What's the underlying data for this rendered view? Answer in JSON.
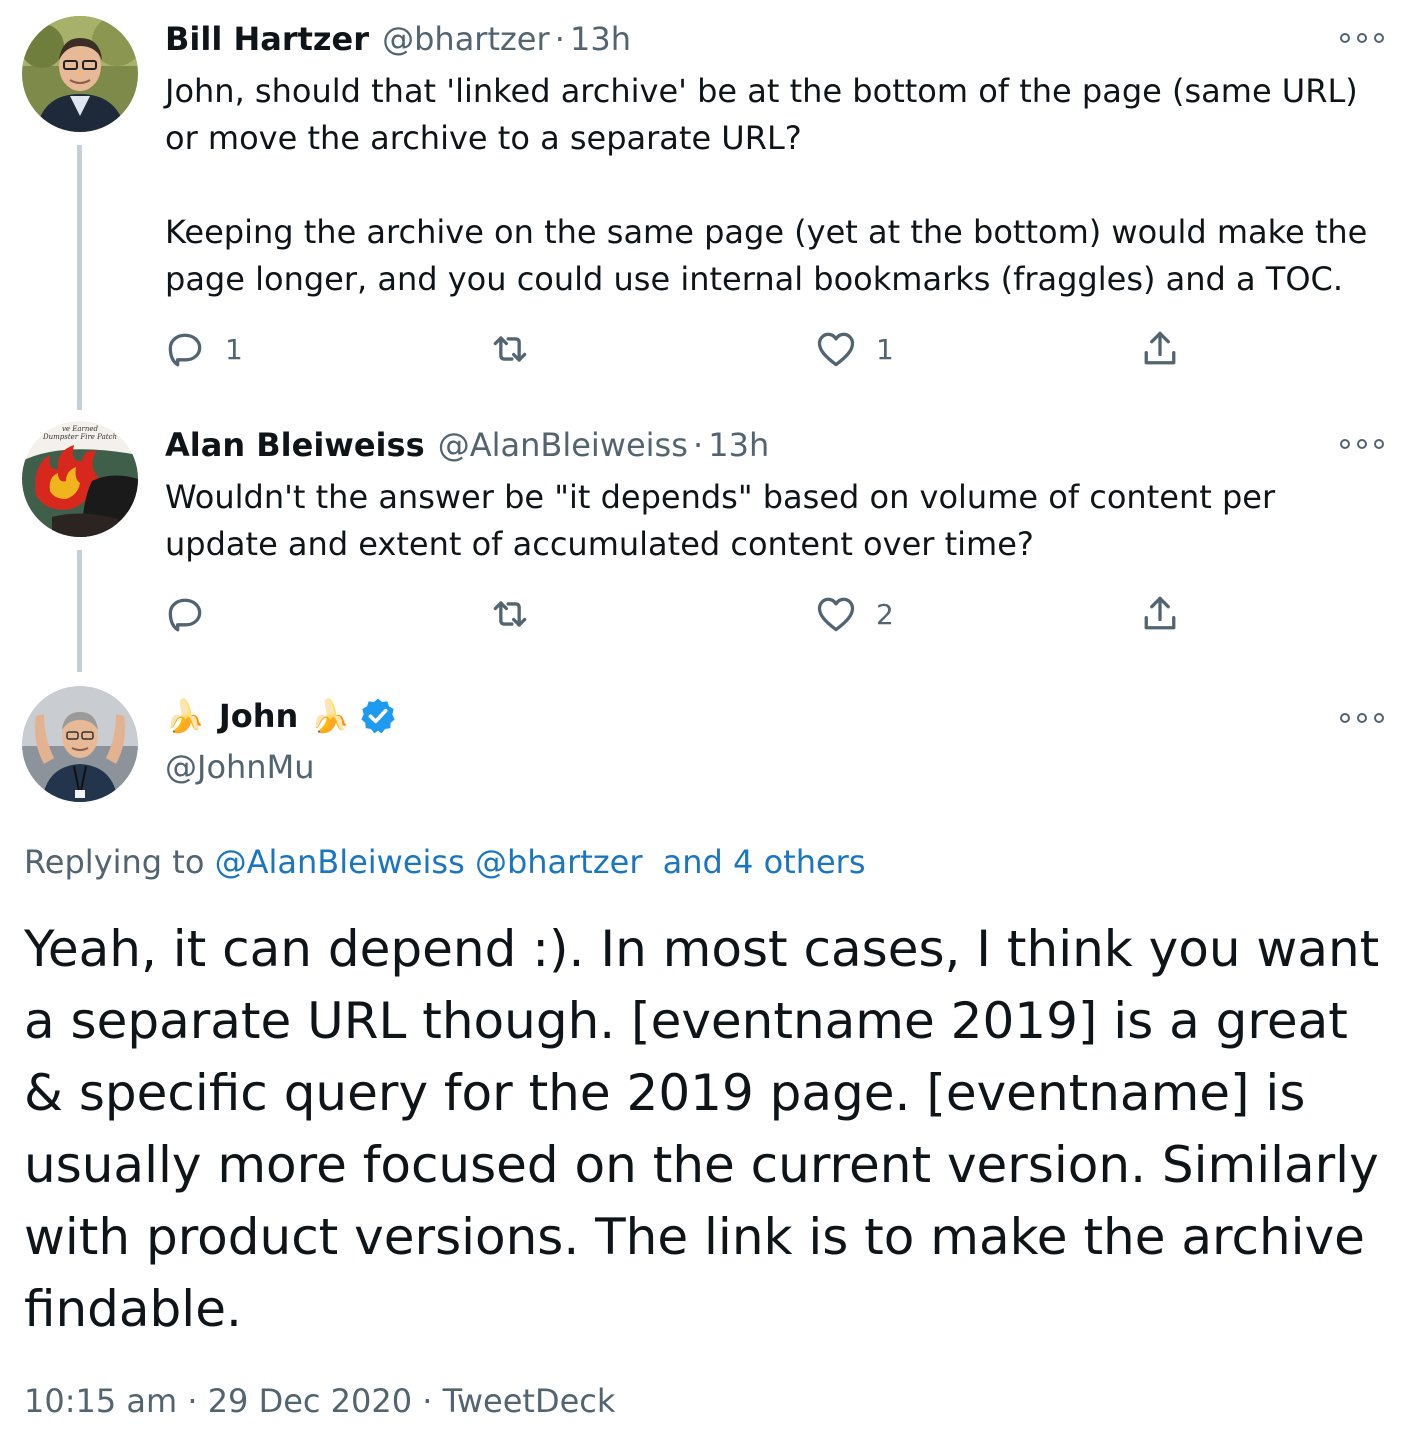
{
  "tweets": [
    {
      "name": "Bill Hartzer",
      "handle": "@bhartzer",
      "time": "13h",
      "text": "John, should that 'linked archive' be at the bottom of the page (same URL) or move the archive to a separate URL?\n\nKeeping the archive on the same page (yet at the bottom) would make the page longer, and you could use internal bookmarks (fraggles) and a TOC.",
      "reply_count": "1",
      "retweet_count": "",
      "like_count": "1"
    },
    {
      "name": "Alan Bleiweiss",
      "handle": "@AlanBleiweiss",
      "time": "13h",
      "avatar_caption_1": "ve Earned",
      "avatar_caption_2": "Dumpster Fire Patch",
      "text": "Wouldn't the answer be \"it depends\" based on volume of content per update and extent of accumulated content over time?",
      "reply_count": "",
      "retweet_count": "",
      "like_count": "2"
    }
  ],
  "main_tweet": {
    "name_emoji": "🍌",
    "name": "John",
    "handle": "@JohnMu",
    "replying_label": "Replying to",
    "replying_users": [
      "@AlanBleiweiss",
      "@bhartzer"
    ],
    "replying_others": "and 4 others",
    "text": "Yeah, it can depend :). In most cases, I think you want a separate URL though. [eventname 2019] is a great & specific query for the 2019 page. [eventname] is usually more focused on the current version. Similarly with product versions. The link is to make the archive findable.",
    "time": "10:15 am",
    "date": "29 Dec 2020",
    "source": "TweetDeck",
    "separator": "·"
  },
  "separator": "·",
  "colors": {
    "text": "#0f1419",
    "muted": "#536471",
    "link": "#1b76c1",
    "thread_line": "#c4cfd6",
    "verified": "#1d9bf0"
  },
  "icons": [
    "reply-icon",
    "retweet-icon",
    "like-icon",
    "share-icon",
    "more-icon",
    "verified-badge-icon",
    "banana-icon"
  ]
}
